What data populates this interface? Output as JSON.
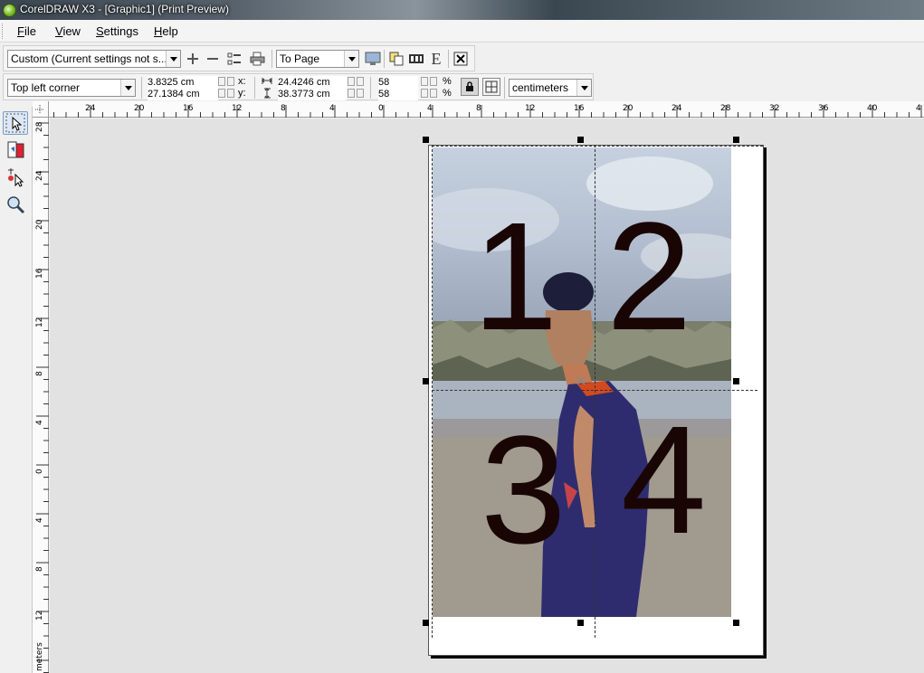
{
  "window": {
    "title": "CorelDRAW X3 - [Graphic1] (Print Preview)"
  },
  "menu": [
    "File",
    "View",
    "Settings",
    "Help"
  ],
  "toolbar1": {
    "preset": "Custom (Current settings not s...",
    "fit": "To Page"
  },
  "toolbar2": {
    "position": "Top left corner",
    "x_value": "3.8325 cm",
    "y_value": "27.1384 cm",
    "x_label": "x:",
    "y_label": "y:",
    "width_value": "24.4246 cm",
    "height_value": "38.3773 cm",
    "scale_x": "58",
    "scale_y": "58",
    "pct": "%",
    "units": "centimeters"
  },
  "ruler_top_labels": [
    "24",
    "20",
    "16",
    "12",
    "8",
    "4",
    "0",
    "4",
    "8",
    "12",
    "16",
    "20",
    "24",
    "28",
    "32",
    "36",
    "40",
    "4"
  ],
  "ruler_left_labels": [
    "28",
    "24",
    "20",
    "16",
    "12",
    "8",
    "4",
    "0",
    "4",
    "8",
    "12"
  ],
  "ruler_unit": "meters",
  "tiles": [
    "1",
    "2",
    "3",
    "4"
  ],
  "icons": {
    "toolbox": [
      "pick-tool-icon",
      "imposition-layout-icon",
      "marks-placement-icon",
      "zoom-tool-icon"
    ]
  }
}
